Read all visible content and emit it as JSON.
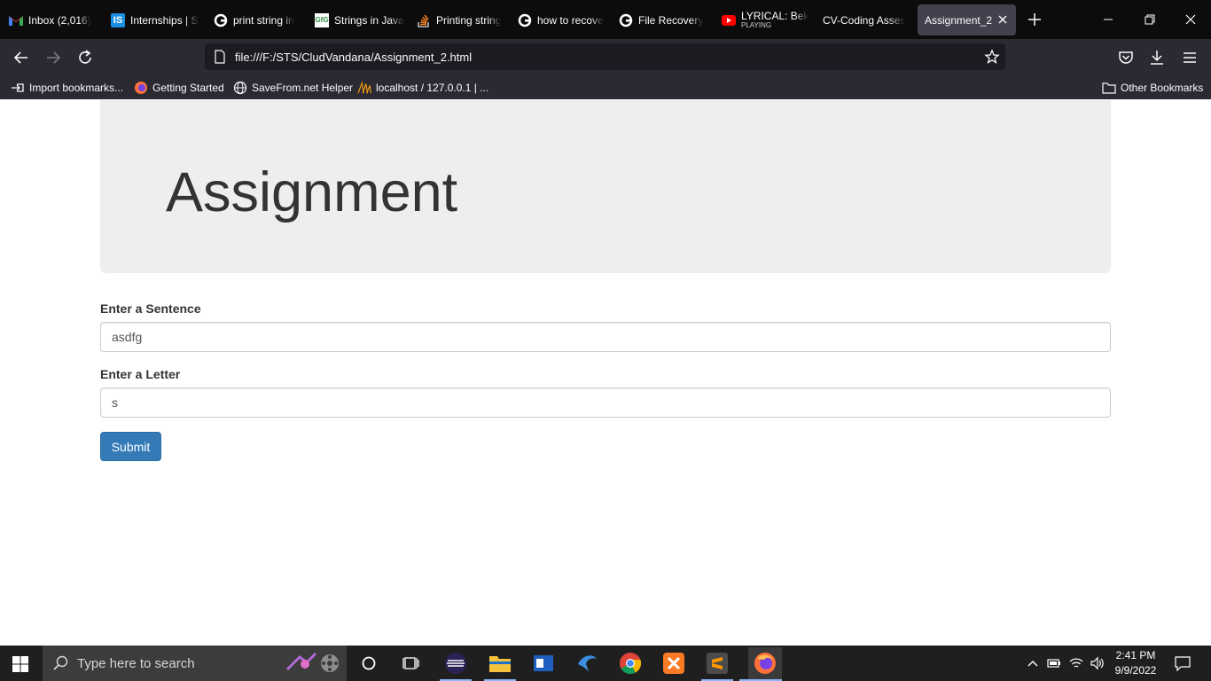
{
  "browser": {
    "tabs": [
      {
        "label": "Inbox (2,016)",
        "icon": "gmail-icon"
      },
      {
        "label": "Internships | S",
        "icon": "internshala-icon"
      },
      {
        "label": "print string in",
        "icon": "google-icon"
      },
      {
        "label": "Strings in Java",
        "icon": "site-icon"
      },
      {
        "label": "Printing string",
        "icon": "stackoverflow-icon"
      },
      {
        "label": "how to recove",
        "icon": "google-icon"
      },
      {
        "label": "File Recovery",
        "icon": "google-icon"
      },
      {
        "label": "LYRICAL: Bek",
        "sublabel": "PLAYING",
        "icon": "youtube-icon"
      },
      {
        "label": "CV-Coding Asses",
        "icon": ""
      },
      {
        "label": "Assignment_2",
        "icon": "",
        "active": true
      }
    ],
    "url": "file:///F:/STS/CludVandana/Assignment_2.html",
    "bookmarks": [
      {
        "label": "Import bookmarks...",
        "icon": "import-icon"
      },
      {
        "label": "Getting Started",
        "icon": "firefox-icon"
      },
      {
        "label": "SaveFrom.net Helper",
        "icon": "globe-icon"
      },
      {
        "label": "localhost / 127.0.0.1 | ...",
        "icon": "phpmyadmin-icon"
      }
    ],
    "other_bookmarks": "Other Bookmarks"
  },
  "page": {
    "title": "Assignment",
    "sentence_label": "Enter a Sentence",
    "sentence_value": "asdfg",
    "letter_label": "Enter a Letter",
    "letter_value": "s",
    "submit_label": "Submit"
  },
  "taskbar": {
    "search_placeholder": "Type here to search",
    "time": "2:41 PM",
    "date": "9/9/2022"
  },
  "colors": {
    "primary_button": "#337ab7",
    "jumbotron": "#eeeeee",
    "chrome_dark": "#2b2a33"
  }
}
